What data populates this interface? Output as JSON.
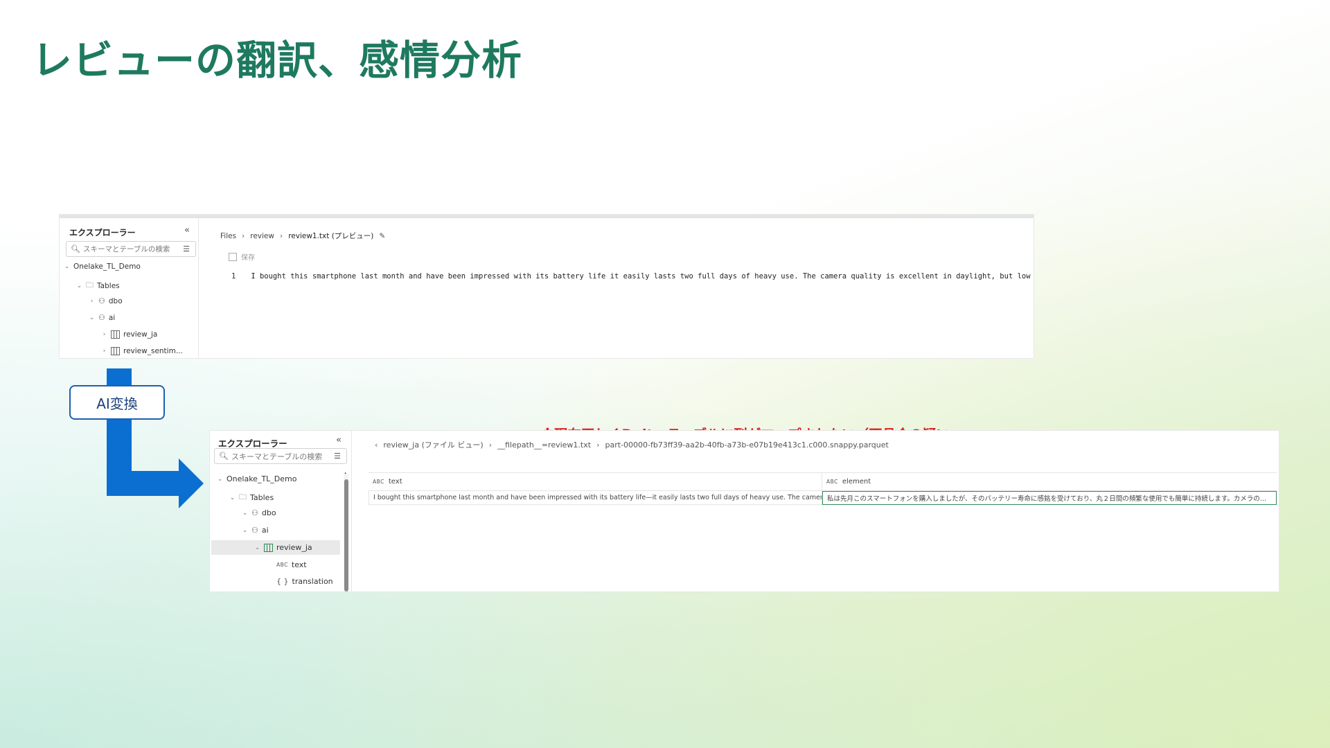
{
  "slide": {
    "title": "レビューの翻訳、感情分析"
  },
  "top_shot": {
    "explorer_title": "エクスプローラー",
    "search_placeholder": "スキーマとテーブルの検索",
    "tree": [
      "Onelake_TL_Demo",
      "Tables",
      "dbo",
      "ai",
      "review_ja",
      "review_sentim..."
    ],
    "breadcrumb": [
      "Files",
      "review",
      "review1.txt (プレビュー)"
    ],
    "save_label": "保存",
    "line_number": "1",
    "line_text": "I bought this smartphone last month and have been impressed with its battery life it easily lasts two full days of heavy use. The camera quality is excellent in daylight, but low light shots"
  },
  "transform_label": "AI変換",
  "warning": "※現在正しくDelta テーブルに列がマップされない（不具合の疑い",
  "bottom_shot": {
    "explorer_title": "エクスプローラー",
    "search_placeholder": "スキーマとテーブルの検索",
    "tree": [
      "Onelake_TL_Demo",
      "Tables",
      "dbo",
      "ai",
      "review_ja",
      "text",
      "translation"
    ],
    "breadcrumb": [
      "review_ja (ファイル ビュー)",
      "__filepath__=review1.txt",
      "part-00000-fb73ff39-aa2b-40fb-a73b-e07b19e413c1.c000.snappy.parquet"
    ],
    "grid": {
      "columns": [
        "text",
        "element"
      ],
      "rows": [
        [
          "I bought this smartphone last month and have been impressed with its battery life—it easily lasts two full days of heavy use. The camera quality is exce...",
          "私は先月このスマートフォンを購入しましたが、そのバッテリー寿命に感銘を受けており、丸２日間の頻繁な使用でも簡単に持続します。カメラの..."
        ]
      ]
    }
  },
  "colors": {
    "title": "#1e7a5f",
    "arrow": "#0a6fd1",
    "warning": "#e01e1e",
    "selection": "#2e8b57"
  }
}
